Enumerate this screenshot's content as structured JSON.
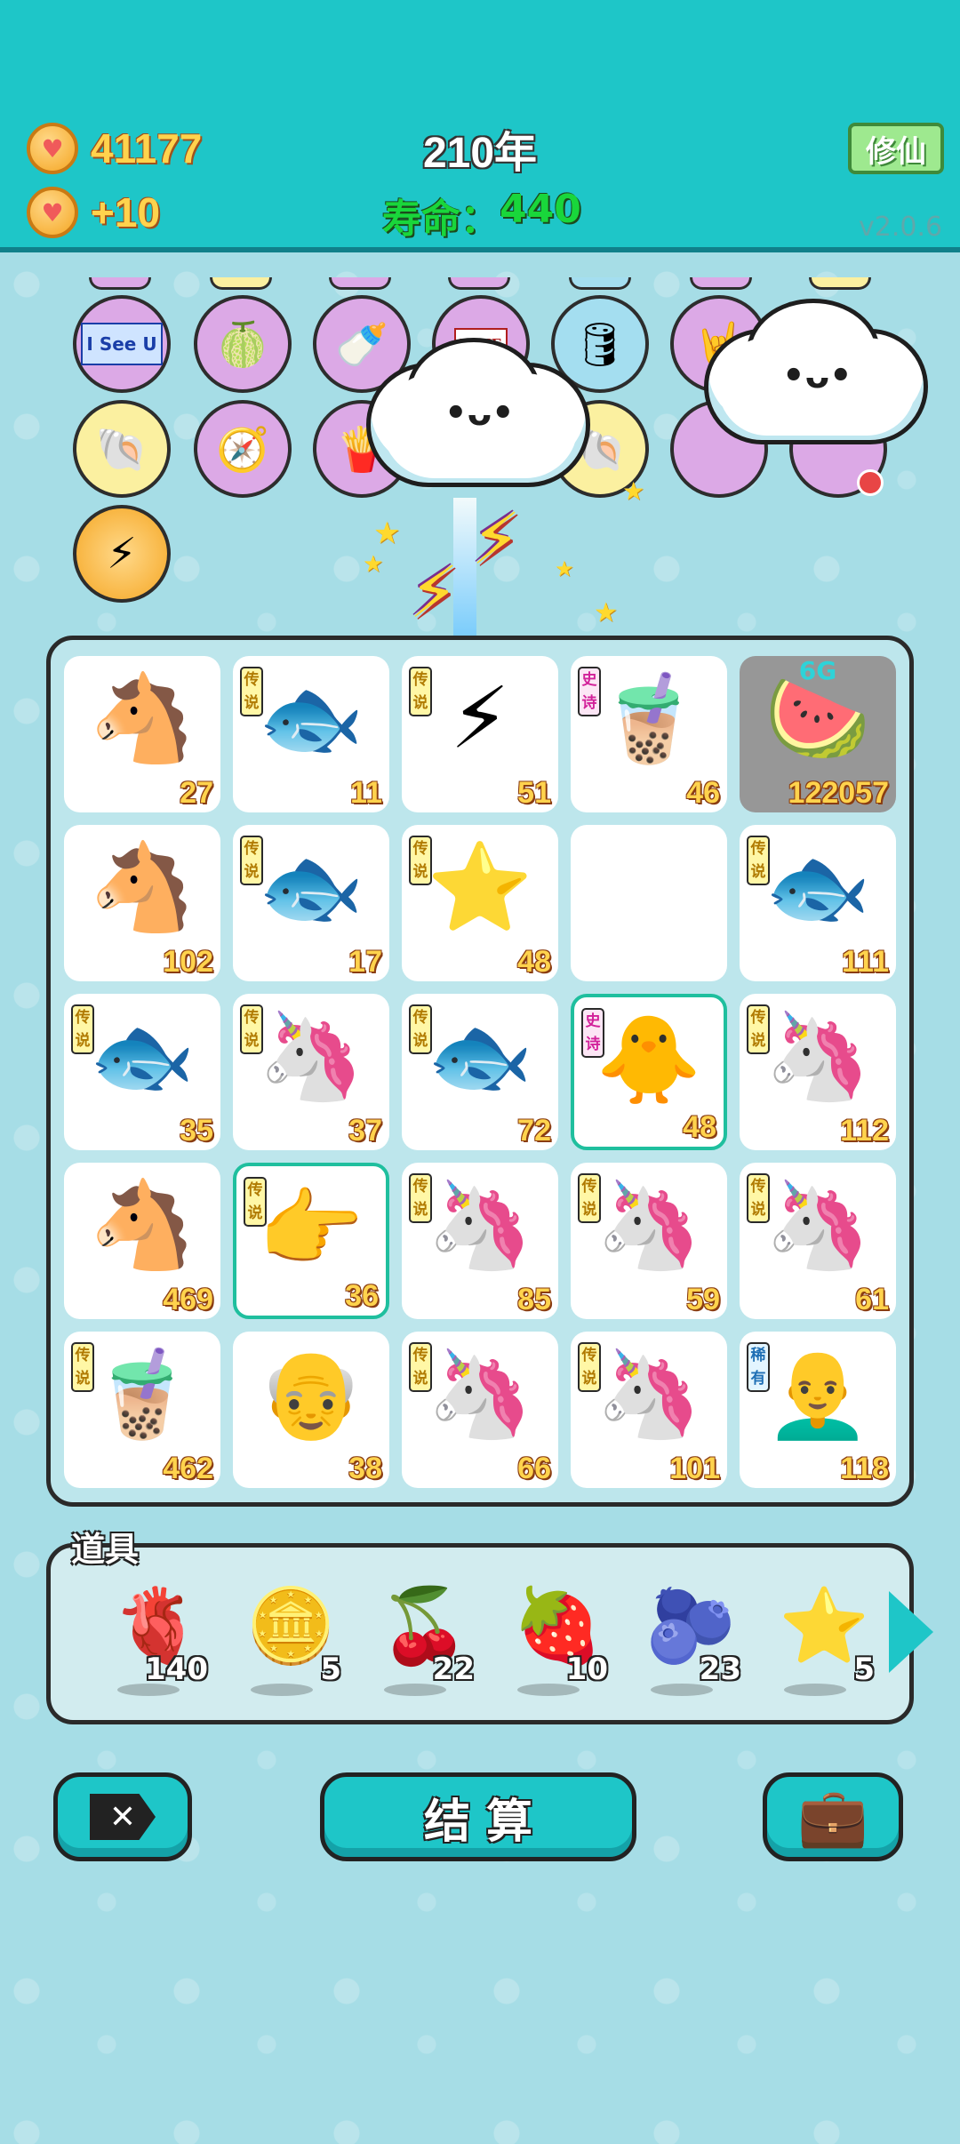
{
  "header": {
    "coins": "41177",
    "coin_income": "+10",
    "year": "210年",
    "lifespan_label": "寿命：",
    "lifespan_value": "440",
    "cultivate_label": "修仙",
    "version": "v2.0.6"
  },
  "relics": [
    {
      "name": "i-see-u-sign",
      "label": "I See U"
    },
    {
      "name": "pomelo",
      "icon": "🍈"
    },
    {
      "name": "breast-pump",
      "icon": "🍼"
    },
    {
      "name": "time-magazine",
      "label": "TIME"
    },
    {
      "name": "bike-pump",
      "icon": "🛢"
    },
    {
      "name": "rock-hand",
      "icon": "🤘"
    },
    {
      "name": "seashell",
      "icon": "🐚"
    },
    {
      "name": "compass",
      "icon": "🧭"
    },
    {
      "name": "french-fries",
      "icon": "🍟"
    },
    {
      "name": "seashell-2",
      "icon": "🐚"
    },
    {
      "name": "lightning-coin",
      "icon": "⚡"
    }
  ],
  "grid": [
    [
      {
        "icon": "🐴",
        "num": "27",
        "tag": ""
      },
      {
        "icon": "🐟",
        "num": "11",
        "tag": "传说"
      },
      {
        "icon": "⚡",
        "num": "51",
        "tag": "传说"
      },
      {
        "icon": "🧋",
        "num": "46",
        "tag": "史诗",
        "tag_type": "epic"
      },
      {
        "icon": "🍉",
        "num": "122057",
        "tag": "",
        "label": "6G"
      }
    ],
    [
      {
        "icon": "🐴",
        "num": "102",
        "tag": ""
      },
      {
        "icon": "🐟",
        "num": "17",
        "tag": "传说"
      },
      {
        "icon": "⭐",
        "num": "48",
        "tag": "传说"
      },
      {
        "icon": "",
        "num": "",
        "tag": ""
      },
      {
        "icon": "🐟",
        "num": "111",
        "tag": "传说"
      }
    ],
    [
      {
        "icon": "🐟",
        "num": "35",
        "tag": "传说"
      },
      {
        "icon": "🦄",
        "num": "37",
        "tag": "传说"
      },
      {
        "icon": "🐟",
        "num": "72",
        "tag": "传说"
      },
      {
        "icon": "🐥",
        "num": "48",
        "tag": "史诗",
        "tag_type": "epic"
      },
      {
        "icon": "🦄",
        "num": "112",
        "tag": "传说"
      }
    ],
    [
      {
        "icon": "🐴",
        "num": "469",
        "tag": ""
      },
      {
        "icon": "👉",
        "num": "36",
        "tag": "传说"
      },
      {
        "icon": "🦄",
        "num": "85",
        "tag": "传说"
      },
      {
        "icon": "🦄",
        "num": "59",
        "tag": "传说"
      },
      {
        "icon": "🦄",
        "num": "61",
        "tag": "传说"
      }
    ],
    [
      {
        "icon": "🧋",
        "num": "462",
        "tag": "传说"
      },
      {
        "icon": "👴",
        "num": "38",
        "tag": ""
      },
      {
        "icon": "🦄",
        "num": "66",
        "tag": "传说"
      },
      {
        "icon": "🦄",
        "num": "101",
        "tag": "传说"
      },
      {
        "icon": "👨‍🦲",
        "num": "118",
        "tag": "稀有",
        "tag_type": "rare"
      }
    ]
  ],
  "props": {
    "title": "道具",
    "items": [
      {
        "name": "liver",
        "icon": "🫀",
        "count": "140"
      },
      {
        "name": "coin",
        "icon": "🪙",
        "count": "5"
      },
      {
        "name": "bayberry",
        "icon": "🍒",
        "count": "22"
      },
      {
        "name": "strawberry",
        "icon": "🍓",
        "count": "10"
      },
      {
        "name": "blueberry",
        "icon": "🫐",
        "count": "23"
      },
      {
        "name": "star",
        "icon": "⭐",
        "count": "5"
      }
    ]
  },
  "buttons": {
    "close": "✕",
    "settle": "结 算",
    "bag": "💼"
  }
}
